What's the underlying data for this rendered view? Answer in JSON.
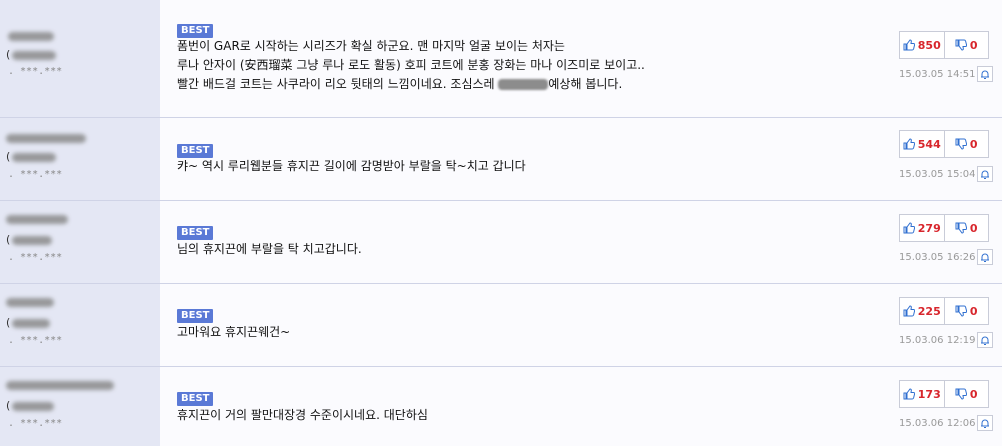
{
  "comments": [
    {
      "ip": ". ***.***",
      "paren": "(",
      "badge": "BEST",
      "lines": [
        "폼번이 GAR로 시작하는 시리즈가 확실 하군요. 맨 마지막 얼굴 보이는 처자는",
        "루나 안자이 (安西瑠菜 그냥 루나 로도 활동) 호피 코트에 분홍 장화는 마나 이즈미로 보이고..",
        "빨간 배드걸 코트는 사쿠라이 리오 뒷태의 느낌이네요. 조심스레",
        "예상해 봅니다."
      ],
      "likes": "850",
      "dislikes": "0",
      "date": "15.03.05 14:51"
    },
    {
      "ip": ". ***.***",
      "paren": "(",
      "badge": "BEST",
      "lines": [
        "캬~ 역시 루리웹분들 휴지끈 길이에 감명받아 부랄을 탁~치고 갑니다"
      ],
      "likes": "544",
      "dislikes": "0",
      "date": "15.03.05 15:04"
    },
    {
      "ip": ". ***.***",
      "paren": "(",
      "badge": "BEST",
      "lines": [
        "님의 휴지끈에 부랄을 탁 치고갑니다."
      ],
      "likes": "279",
      "dislikes": "0",
      "date": "15.03.05 16:26"
    },
    {
      "ip": ". ***.***",
      "paren": "(",
      "badge": "BEST",
      "lines": [
        "고마워요 휴지끈웨건~"
      ],
      "likes": "225",
      "dislikes": "0",
      "date": "15.03.06 12:19"
    },
    {
      "ip": ". ***.***",
      "paren": "(",
      "badge": "BEST",
      "lines": [
        "휴지끈이 거의 팔만대장경 수준이시네요. 대단하심"
      ],
      "likes": "173",
      "dislikes": "0",
      "date": "15.03.06 12:06"
    }
  ],
  "icons": {
    "like": "thumbs-up-icon",
    "dislike": "thumbs-down-icon",
    "report": "bell-icon"
  },
  "colors": {
    "badge": "#5a79d6",
    "count": "#d8262c",
    "icon": "#2f6fd0"
  }
}
